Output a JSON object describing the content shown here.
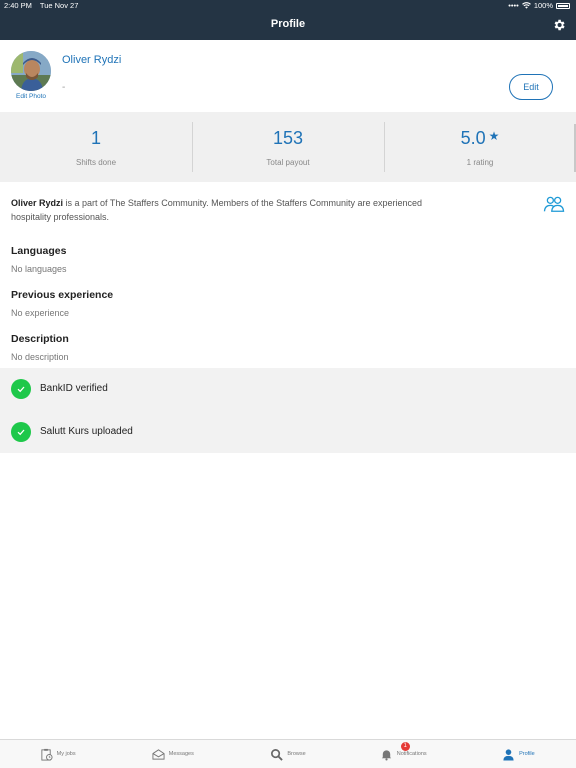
{
  "status_bar": {
    "time": "2:40 PM",
    "date": "Tue Nov 27",
    "battery": "100%"
  },
  "header": {
    "title": "Profile"
  },
  "profile": {
    "name": "Oliver Rydzi",
    "subtitle": "-",
    "edit_photo_label": "Edit Photo",
    "edit_label": "Edit"
  },
  "stats": [
    {
      "value": "1",
      "label": "Shifts done"
    },
    {
      "value": "153",
      "label": "Total payout"
    },
    {
      "value": "5.0",
      "label": "1 rating"
    }
  ],
  "intro": {
    "name": "Oliver Rydzi",
    "text": " is a part of The Staffers Community. Members of the Staffers Community are experienced hospitality professionals."
  },
  "sections": [
    {
      "title": "Languages",
      "value": "No languages"
    },
    {
      "title": "Previous experience",
      "value": "No experience"
    },
    {
      "title": "Description",
      "value": "No description"
    }
  ],
  "verifications": [
    {
      "label": "BankID verified"
    },
    {
      "label": "Salutt Kurs uploaded"
    }
  ],
  "tabbar": {
    "tabs": [
      {
        "label": "My jobs",
        "icon": "clipboard-clock-icon"
      },
      {
        "label": "Messages",
        "icon": "envelope-icon"
      },
      {
        "label": "Browse",
        "icon": "search-icon"
      },
      {
        "label": "Notifications",
        "icon": "bell-icon",
        "badge": "1"
      },
      {
        "label": "Profile",
        "icon": "person-icon",
        "active": true
      }
    ]
  },
  "colors": {
    "header_bg": "#243444",
    "accent": "#1f73b7",
    "verified_green": "#1ec84a",
    "badge_red": "#e53935"
  }
}
